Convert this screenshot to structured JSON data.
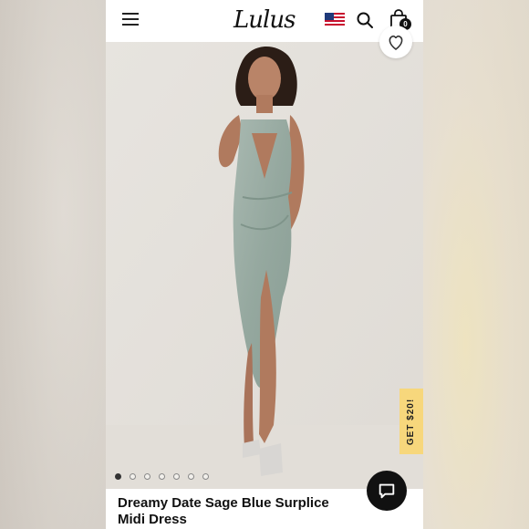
{
  "header": {
    "logo_text": "Lulus",
    "cart_count": "0"
  },
  "icons": {
    "menu": "hamburger-menu-icon",
    "flag": "us-flag-icon",
    "search": "search-icon",
    "bag": "shopping-bag-icon",
    "wishlist": "heart-icon",
    "chat": "chat-bubble-icon"
  },
  "promo": {
    "label": "GET $20!"
  },
  "gallery": {
    "slide_count": 7,
    "active_index": 0
  },
  "product": {
    "title": "Dreamy Date Sage Blue Surplice Midi Dress",
    "color": "#9eb0a7"
  },
  "colors": {
    "promo_bg": "#f7d77c",
    "chat_bg": "#111111"
  }
}
